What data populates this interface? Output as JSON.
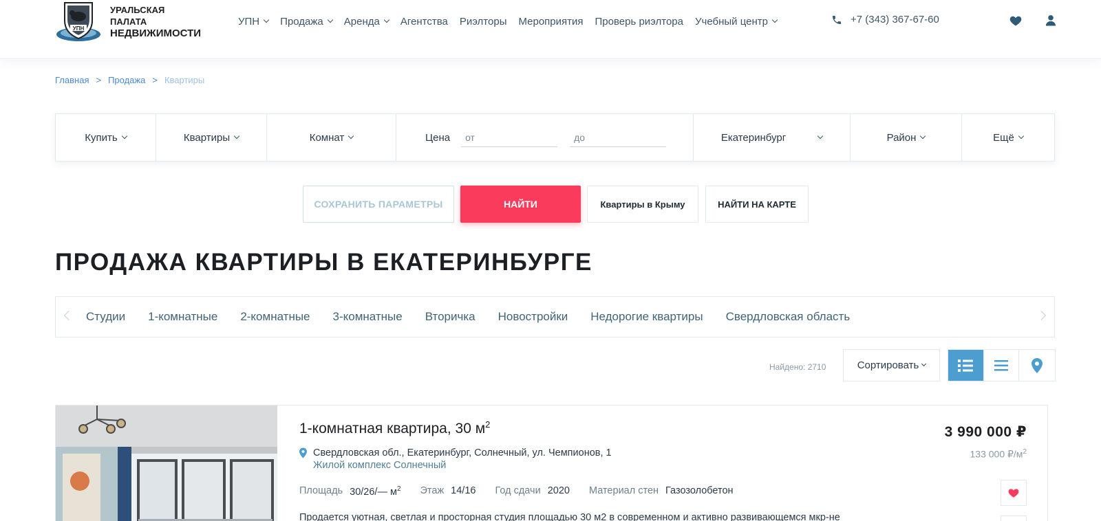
{
  "header": {
    "logo": {
      "line1": "УРАЛЬСКАЯ ПАЛАТА",
      "line2": "НЕДВИЖИМОСТИ",
      "emblem_text": "УПН"
    },
    "nav": [
      {
        "label": "УПН",
        "dropdown": true
      },
      {
        "label": "Продажа",
        "dropdown": true
      },
      {
        "label": "Аренда",
        "dropdown": true
      },
      {
        "label": "Агентства",
        "dropdown": false
      },
      {
        "label": "Риэлторы",
        "dropdown": false
      },
      {
        "label": "Мероприятия",
        "dropdown": false
      },
      {
        "label": "Проверь риэлтора",
        "dropdown": false
      },
      {
        "label": "Учебный центр",
        "dropdown": true
      }
    ],
    "phone": "+7 (343) 367-67-60",
    "icons": [
      "phone-icon",
      "heart-icon",
      "user-icon"
    ]
  },
  "breadcrumb": {
    "items": [
      "Главная",
      "Продажа",
      "Квартиры"
    ],
    "separator": ">"
  },
  "filter": {
    "deal": "Купить",
    "type": "Квартиры",
    "rooms": "Комнат",
    "price_label": "Цена",
    "price_from_placeholder": "от",
    "price_to_placeholder": "до",
    "city": "Екатеринбург",
    "district": "Район",
    "more": "Ещё"
  },
  "actions": {
    "save": "СОХРАНИТЬ ПАРАМЕТРЫ",
    "find": "НАЙТИ",
    "crimea": "Квартиры в Крыму",
    "map": "НАЙТИ НА КАРТЕ"
  },
  "page_title": "ПРОДАЖА КВАРТИРЫ В ЕКАТЕРИНБУРГЕ",
  "categories": [
    "Студии",
    "1-комнатные",
    "2-комнатные",
    "3-комнатные",
    "Вторичка",
    "Новостройки",
    "Недорогие квартиры",
    "Свердловская область"
  ],
  "results": {
    "found": "Найдено: 2710",
    "sort": "Сортировать",
    "view_modes": [
      "list-detail-icon",
      "list-icon",
      "map-pin-icon"
    ],
    "active_view": "list-detail-icon"
  },
  "listing": {
    "title": "1-комнатная квартира, 30 м",
    "title_sup": "2",
    "address": "Свердловская обл., Екатеринбург, Солнечный, ул. Чемпионов, 1",
    "complex": "Жилой комплекс Солнечный",
    "area_label": "Площадь",
    "area_value": "30/26/— м",
    "area_sup": "2",
    "floor_label": "Этаж",
    "floor_value": "14/16",
    "year_label": "Год сдачи",
    "year_value": "2020",
    "material_label": "Материал стен",
    "material_value": "Газозолобетон",
    "description": "Продается уютная, светлая и просторная студия площадью 30 м2 в современном и активно развивающемся мкр-не",
    "price": "3 990 000 ₽",
    "price_per_m2": "133 000 ₽/м",
    "price_per_m2_sup": "2"
  },
  "colors": {
    "accent_red": "#fb3b5c",
    "accent_blue": "#4c9ed0",
    "link_blue": "#4a8ad4"
  }
}
